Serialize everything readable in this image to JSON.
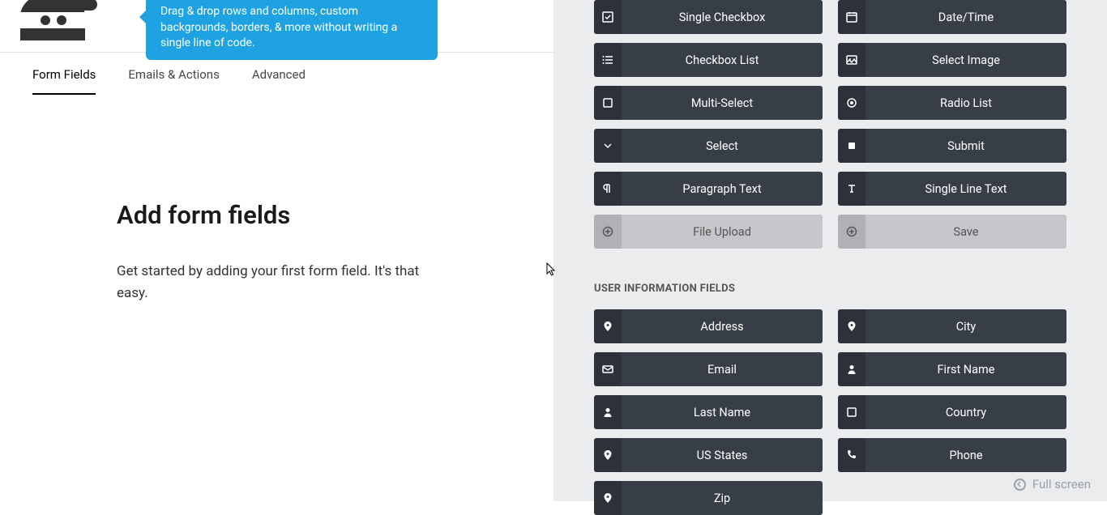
{
  "tooltip": "Drag & drop rows and columns, custom backgrounds, borders, & more without writing a single line of code.",
  "tabs": {
    "form_fields": "Form Fields",
    "emails_actions": "Emails & Actions",
    "advanced": "Advanced"
  },
  "main": {
    "title": "Add form fields",
    "subtitle": "Get started by adding your first form field. It's that easy."
  },
  "common_fields": [
    {
      "label": "Single Checkbox",
      "icon": "check-square",
      "disabled": false
    },
    {
      "label": "Date/Time",
      "icon": "calendar",
      "disabled": false
    },
    {
      "label": "Checkbox List",
      "icon": "list",
      "disabled": false
    },
    {
      "label": "Select Image",
      "icon": "image",
      "disabled": false
    },
    {
      "label": "Multi-Select",
      "icon": "square",
      "disabled": false
    },
    {
      "label": "Radio List",
      "icon": "radio",
      "disabled": false
    },
    {
      "label": "Select",
      "icon": "chevron-down",
      "disabled": false
    },
    {
      "label": "Submit",
      "icon": "square-filled",
      "disabled": false
    },
    {
      "label": "Paragraph Text",
      "icon": "paragraph",
      "disabled": false
    },
    {
      "label": "Single Line Text",
      "icon": "text-cursor",
      "disabled": false
    },
    {
      "label": "File Upload",
      "icon": "plus-circle",
      "disabled": true
    },
    {
      "label": "Save",
      "icon": "plus-circle",
      "disabled": true
    }
  ],
  "user_info_heading": "USER INFORMATION FIELDS",
  "user_fields": [
    {
      "label": "Address",
      "icon": "map-pin"
    },
    {
      "label": "City",
      "icon": "map-pin"
    },
    {
      "label": "Email",
      "icon": "envelope"
    },
    {
      "label": "First Name",
      "icon": "user"
    },
    {
      "label": "Last Name",
      "icon": "user"
    },
    {
      "label": "Country",
      "icon": "square"
    },
    {
      "label": "US States",
      "icon": "map-pin"
    },
    {
      "label": "Phone",
      "icon": "phone"
    },
    {
      "label": "Zip",
      "icon": "map-pin"
    }
  ],
  "full_screen": "Full screen"
}
